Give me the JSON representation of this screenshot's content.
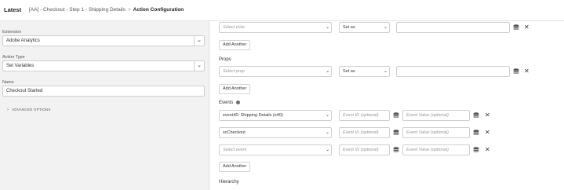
{
  "header": {
    "latest": "Latest",
    "breadcrumb_rule": "[AA] - Checkout - Step 1 - Shipping Details",
    "separator": ">",
    "breadcrumb_current": "Action Configuration"
  },
  "left": {
    "extension_label": "Extension",
    "extension_value": "Adobe Analytics",
    "action_type_label": "Action Type",
    "action_type_value": "Set Variables",
    "name_label": "Name",
    "name_value": "Checkout Started",
    "advanced_options": "ADVANCED OPTIONS"
  },
  "evars": {
    "select_placeholder": "Select eVar",
    "set_as": "Set as",
    "add_another": "Add Another"
  },
  "props": {
    "label": "Props",
    "select_placeholder": "Select prop",
    "set_as": "Set as",
    "add_another": "Add Another"
  },
  "events": {
    "label": "Events",
    "id_placeholder": "Event ID (optional)",
    "value_placeholder": "Event Value (optional)",
    "rows": [
      {
        "event": "event40: Shipping Details (e40)",
        "placeholder": false
      },
      {
        "event": "scCheckout",
        "placeholder": false
      },
      {
        "event": "Select event",
        "placeholder": true
      }
    ],
    "add_another": "Add Another"
  },
  "hierarchy": {
    "label": "Hierarchy"
  },
  "icons": {
    "db": "database-icon",
    "close": "close-icon",
    "chevron": "chevron-down-icon",
    "info": "info-icon"
  }
}
